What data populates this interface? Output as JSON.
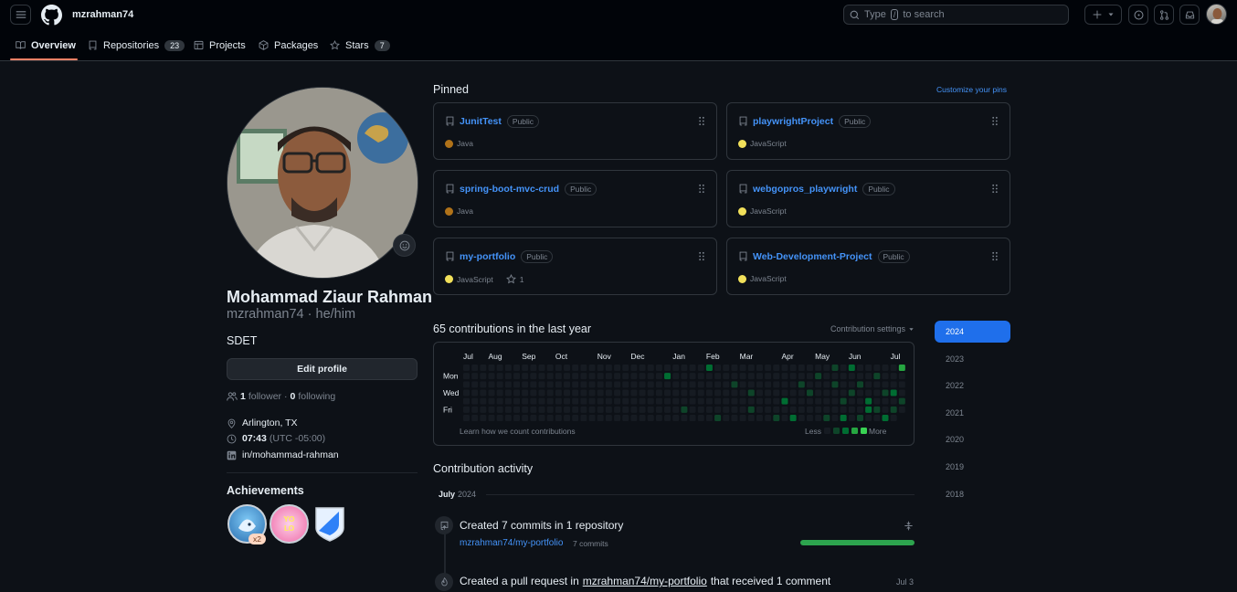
{
  "header": {
    "username": "mzrahman74",
    "search_prefix": "Type",
    "search_key": "/",
    "search_suffix": "to search"
  },
  "tabs": [
    {
      "label": "Overview",
      "icon": "book-icon"
    },
    {
      "label": "Repositories",
      "count": "23",
      "icon": "repo-icon"
    },
    {
      "label": "Projects",
      "icon": "table-icon"
    },
    {
      "label": "Packages",
      "icon": "package-icon"
    },
    {
      "label": "Stars",
      "count": "7",
      "icon": "star-icon"
    }
  ],
  "profile": {
    "name": "Mohammad Ziaur Rahman",
    "login_pronouns": "mzrahman74 · he/him",
    "bio": "SDET",
    "edit_button": "Edit profile",
    "followers_count": "1",
    "followers_label": "follower",
    "sep": "·",
    "following_count": "0",
    "following_label": "following",
    "location": "Arlington, TX",
    "local_time": "07:43",
    "timezone": "(UTC -05:00)",
    "linkedin": "in/mohammad-rahman",
    "achievements_title": "Achievements",
    "achievement_multiplier": "x2"
  },
  "pinned": {
    "title": "Pinned",
    "customize": "Customize your pins",
    "visibility": "Public",
    "cards": [
      {
        "name": "JunitTest",
        "language": "Java",
        "lang_color": "#b07219"
      },
      {
        "name": "playwrightProject",
        "language": "JavaScript",
        "lang_color": "#f1e05a"
      },
      {
        "name": "spring-boot-mvc-crud",
        "language": "Java",
        "lang_color": "#b07219"
      },
      {
        "name": "webgopros_playwright",
        "language": "JavaScript",
        "lang_color": "#f1e05a"
      },
      {
        "name": "my-portfolio",
        "language": "JavaScript",
        "lang_color": "#f1e05a",
        "stars": "1"
      },
      {
        "name": "Web-Development-Project",
        "language": "JavaScript",
        "lang_color": "#f1e05a"
      }
    ]
  },
  "contributions": {
    "title": "65 contributions in the last year",
    "settings": "Contribution settings",
    "months": [
      "Jul",
      "Aug",
      "Sep",
      "Oct",
      "Nov",
      "Dec",
      "Jan",
      "Feb",
      "Mar",
      "Apr",
      "May",
      "Jun",
      "Jul"
    ],
    "days": [
      "Mon",
      "Wed",
      "Fri"
    ],
    "learn": "Learn how we count contributions",
    "less": "Less",
    "more": "More",
    "colors": [
      "#161b22",
      "#0e4429",
      "#006d32",
      "#26a641",
      "#39d353"
    ],
    "years": [
      "2024",
      "2023",
      "2022",
      "2021",
      "2020",
      "2019",
      "2018"
    ],
    "selected_year": "2024"
  },
  "activity": {
    "title": "Contribution activity",
    "month": "July",
    "year": "2024",
    "item1_text": "Created 7 commits in 1 repository",
    "item1_repo": "mzrahman74/my-portfolio",
    "item1_commits": "7 commits",
    "item1_fraction": 1.0,
    "item2_prefix": "Created a pull request in",
    "item2_repo": "mzrahman74/my-portfolio",
    "item2_suffix": "that received 1 comment",
    "item2_date": "Jul 3"
  }
}
